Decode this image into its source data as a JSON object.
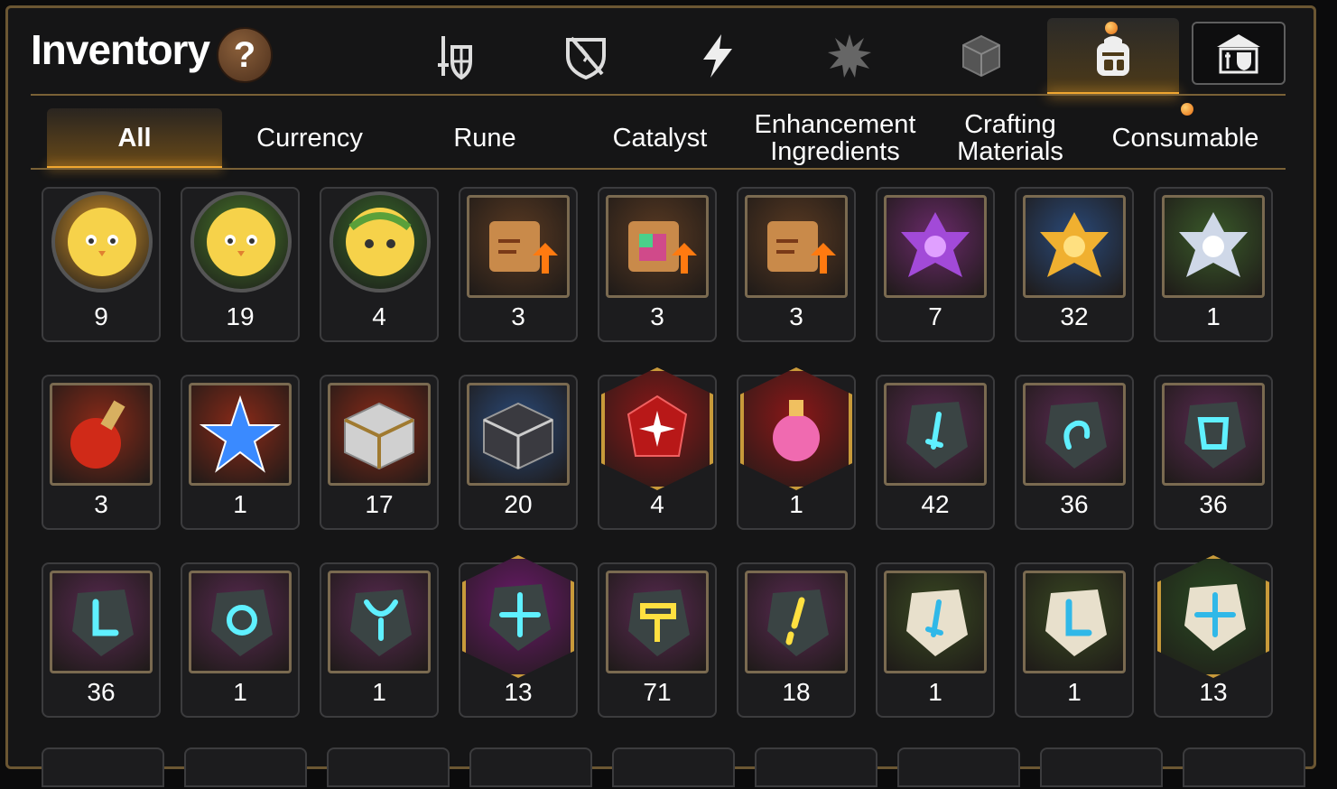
{
  "title": "Inventory",
  "help_label": "?",
  "top_tabs": [
    {
      "icon": "sword-shield-icon",
      "active": false
    },
    {
      "icon": "broken-shield-icon",
      "active": false
    },
    {
      "icon": "lightning-icon",
      "active": false
    },
    {
      "icon": "splash-icon",
      "active": false
    },
    {
      "icon": "cube-icon",
      "active": false
    },
    {
      "icon": "backpack-icon",
      "active": true
    },
    {
      "icon": "guild-icon",
      "active": false
    }
  ],
  "category_tabs": [
    "All",
    "Currency",
    "Rune",
    "Catalyst",
    "Enhancement Ingredients",
    "Crafting Materials",
    "Consumable"
  ],
  "active_category": "All",
  "colors": {
    "accent": "#f0a630",
    "frame": "#6b5632"
  },
  "items": [
    {
      "icon": "yellow-bird-portrait-icon",
      "shape": "circle",
      "bg": "#d9962a",
      "count": "9"
    },
    {
      "icon": "yellow-bird-portrait-icon",
      "shape": "circle",
      "bg": "#4a7a2a",
      "count": "19"
    },
    {
      "icon": "laurel-bird-portrait-icon",
      "shape": "circle",
      "bg": "#3a6a2a",
      "count": "4"
    },
    {
      "icon": "scroll-upgrade-icon",
      "shape": "square",
      "bg": "#5a3a22",
      "count": "3"
    },
    {
      "icon": "rainbow-scroll-icon",
      "shape": "square",
      "bg": "#5a3a22",
      "count": "3"
    },
    {
      "icon": "scroll-upgrade-icon",
      "shape": "square",
      "bg": "#5a3a22",
      "count": "3"
    },
    {
      "icon": "purple-crystal-icon",
      "shape": "square",
      "bg": "#6a2a6a",
      "count": "7"
    },
    {
      "icon": "gold-crystal-icon",
      "shape": "square",
      "bg": "#2a4a7a",
      "count": "32"
    },
    {
      "icon": "silver-crystal-icon",
      "shape": "square",
      "bg": "#3a5a2a",
      "count": "1"
    },
    {
      "icon": "red-potion-icon",
      "shape": "square",
      "bg": "#8a2a18",
      "count": "3"
    },
    {
      "icon": "blue-star-icon",
      "shape": "square",
      "bg": "#8a2a18",
      "count": "1"
    },
    {
      "icon": "silver-chest-icon",
      "shape": "square",
      "bg": "#8a2a18",
      "count": "17"
    },
    {
      "icon": "dark-cube-icon",
      "shape": "square",
      "bg": "#2a4a7a",
      "count": "20"
    },
    {
      "icon": "red-gem-icon",
      "shape": "hex",
      "bg": "#8a1818",
      "count": "4"
    },
    {
      "icon": "pink-potion-icon",
      "shape": "hex",
      "bg": "#8a1818",
      "count": "1"
    },
    {
      "icon": "sword-rune-icon",
      "shape": "square",
      "bg": "#5a2a52",
      "count": "42"
    },
    {
      "icon": "spiral-rune-icon",
      "shape": "square",
      "bg": "#5a2a52",
      "count": "36"
    },
    {
      "icon": "armor-rune-icon",
      "shape": "square",
      "bg": "#5a2a52",
      "count": "36"
    },
    {
      "icon": "boot-rune-icon",
      "shape": "square",
      "bg": "#5a2a52",
      "count": "36"
    },
    {
      "icon": "ring-rune-icon",
      "shape": "square",
      "bg": "#5a2a52",
      "count": "1"
    },
    {
      "icon": "necklace-rune-icon",
      "shape": "square",
      "bg": "#5a2a52",
      "count": "1"
    },
    {
      "icon": "star-rune-icon",
      "shape": "hex",
      "bg": "#6a1a6a",
      "count": "13"
    },
    {
      "icon": "hammer-rune-icon",
      "shape": "square",
      "bg": "#5a2a52",
      "count": "71"
    },
    {
      "icon": "lightning-rune-icon",
      "shape": "square",
      "bg": "#5a2a52",
      "count": "18"
    },
    {
      "icon": "sword-stone-icon",
      "shape": "square",
      "bg": "#3a4a22",
      "count": "1"
    },
    {
      "icon": "boot-stone-icon",
      "shape": "square",
      "bg": "#3a4a22",
      "count": "1"
    },
    {
      "icon": "star-stone-icon",
      "shape": "hex",
      "bg": "#2a4a22",
      "count": "13"
    }
  ]
}
